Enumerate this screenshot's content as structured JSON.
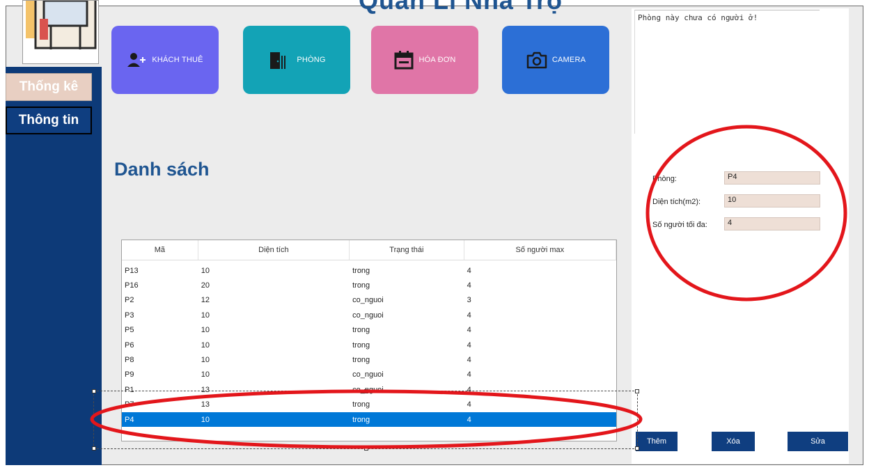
{
  "header": {
    "title_partial": "Quản Lí Nhà Trọ"
  },
  "sidebar": {
    "items": [
      {
        "label": "Thống kê",
        "active": false
      },
      {
        "label": "Thông tin",
        "active": true
      }
    ]
  },
  "tiles": [
    {
      "label": "KHÁCH THUÊ",
      "icon": "add-user-icon",
      "color": "#6a65f0"
    },
    {
      "label": "PHÒNG",
      "icon": "door-icon",
      "color": "#13a3b6"
    },
    {
      "label": "HÓA ĐƠN",
      "icon": "calendar-icon",
      "color": "#e075a7"
    },
    {
      "label": "CAMERA",
      "icon": "camera-icon",
      "color": "#2c6fd6"
    }
  ],
  "list_title": "Danh sách",
  "table": {
    "columns": [
      "Mã",
      "Diện tích",
      "Trạng thái",
      "Số người max"
    ],
    "rows": [
      [
        "P13",
        "10",
        "trong",
        "4"
      ],
      [
        "P16",
        "20",
        "trong",
        "4"
      ],
      [
        "P2",
        "12",
        "co_nguoi",
        "3"
      ],
      [
        "P3",
        "10",
        "co_nguoi",
        "4"
      ],
      [
        "P5",
        "10",
        "trong",
        "4"
      ],
      [
        "P6",
        "10",
        "trong",
        "4"
      ],
      [
        "P8",
        "10",
        "trong",
        "4"
      ],
      [
        "P9",
        "10",
        "co_nguoi",
        "4"
      ],
      [
        "P1",
        "13",
        "co_nguoi",
        "4"
      ],
      [
        "P7",
        "13",
        "trong",
        "4"
      ],
      [
        "P4",
        "10",
        "trong",
        "4"
      ]
    ],
    "selected_index": 10
  },
  "detail": {
    "note": "Phòng này chưa có người ở!",
    "fields": [
      {
        "label": "Phòng:",
        "value": "P4"
      },
      {
        "label": "Diện tích(m2):",
        "value": "10"
      },
      {
        "label": "Số người tối đa:",
        "value": "4"
      }
    ]
  },
  "actions": {
    "add": "Thêm",
    "delete": "Xóa",
    "edit": "Sửa"
  },
  "colors": {
    "navy": "#0d3a78",
    "selection": "#0078d7",
    "annotation": "#e3161b"
  }
}
